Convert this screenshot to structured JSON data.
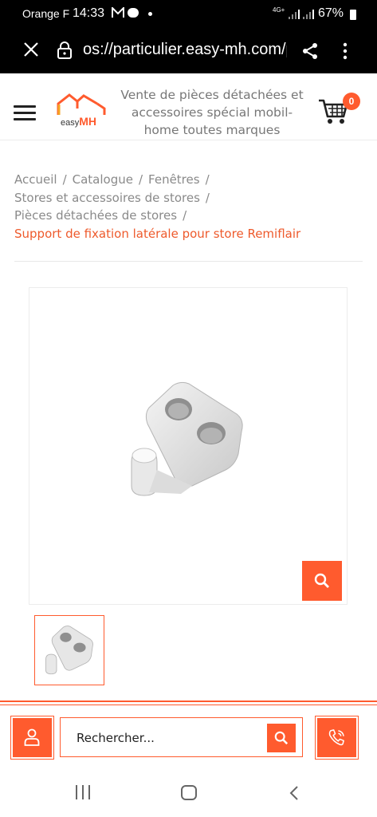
{
  "status_bar": {
    "carrier": "Orange F",
    "time": "14:33",
    "network": "4G+",
    "battery": "67%",
    "icons": [
      "mail-icon",
      "chat-icon",
      "dot-icon",
      "signal-icon",
      "battery-icon"
    ]
  },
  "browser": {
    "url": "os://particulier.easy-mh.com/p",
    "icons": [
      "close-icon",
      "lock-icon",
      "share-icon",
      "more-icon"
    ]
  },
  "header": {
    "logo_prefix": "easy",
    "logo_brand": "MH",
    "tagline": "Vente de pièces détachées et accessoires spécial mobil-home toutes marques",
    "cart_count": "0"
  },
  "breadcrumb": {
    "items": [
      "Accueil",
      "Catalogue",
      "Fenêtres",
      "Stores et accessoires de stores",
      "Pièces détachées de stores"
    ],
    "separator": "/",
    "current": "Support de fixation latérale pour store Remiflair"
  },
  "toolbar": {
    "search_placeholder": "Rechercher..."
  },
  "colors": {
    "accent": "#ff5b2e",
    "breadcrumb_current": "#ee5a2c",
    "text_muted": "#8a8a8a",
    "status_bar_bg": "#000000"
  }
}
